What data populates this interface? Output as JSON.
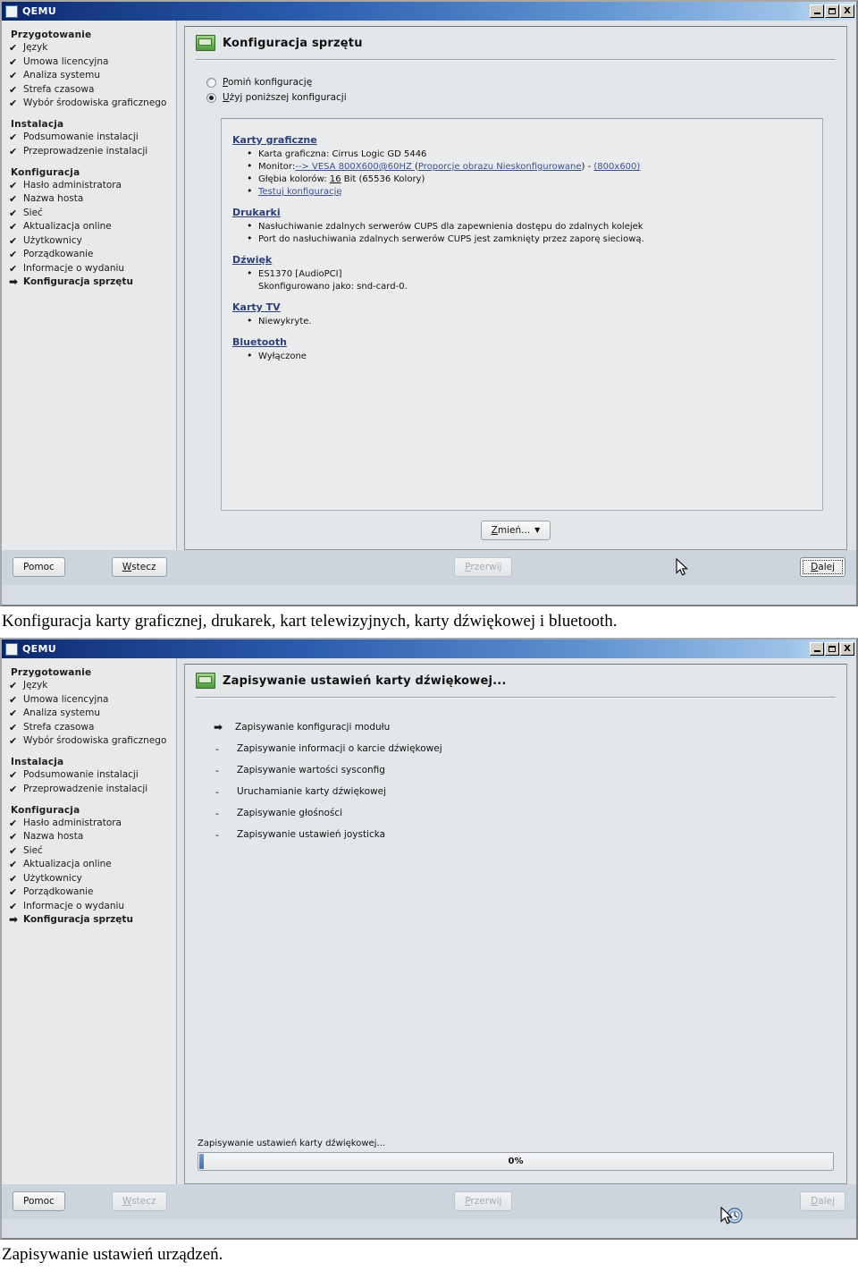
{
  "sidebar": {
    "groups": [
      {
        "title": "Przygotowanie",
        "items": [
          {
            "mark": "✔",
            "label": "Język"
          },
          {
            "mark": "✔",
            "label": "Umowa licencyjna"
          },
          {
            "mark": "✔",
            "label": "Analiza systemu"
          },
          {
            "mark": "✔",
            "label": "Strefa czasowa"
          },
          {
            "mark": "✔",
            "label": "Wybór środowiska graficznego"
          }
        ]
      },
      {
        "title": "Instalacja",
        "items": [
          {
            "mark": "✔",
            "label": "Podsumowanie instalacji"
          },
          {
            "mark": "✔",
            "label": "Przeprowadzenie instalacji"
          }
        ]
      },
      {
        "title": "Konfiguracja",
        "items": [
          {
            "mark": "✔",
            "label": "Hasło administratora"
          },
          {
            "mark": "✔",
            "label": "Nazwa hosta"
          },
          {
            "mark": "✔",
            "label": "Sieć"
          },
          {
            "mark": "✔",
            "label": "Aktualizacja online"
          },
          {
            "mark": "✔",
            "label": "Użytkownicy"
          },
          {
            "mark": "✔",
            "label": "Porządkowanie"
          },
          {
            "mark": "✔",
            "label": "Informacje o wydaniu"
          },
          {
            "mark": "➡",
            "label": "Konfiguracja sprzętu",
            "current": true
          }
        ]
      }
    ]
  },
  "window1": {
    "title": "QEMU",
    "window_buttons": {
      "minimize": "minimize-icon",
      "maximize": "maximize-icon",
      "close": "X"
    },
    "dialog_title": "Konfiguracja sprzętu",
    "radios": [
      {
        "label_pre": "",
        "label_accel": "P",
        "label_post": "omiń konfigurację",
        "selected": false
      },
      {
        "label_pre": "",
        "label_accel": "U",
        "label_post": "żyj poniższej konfiguracji",
        "selected": true
      }
    ],
    "sections": [
      {
        "heading": "Karty graficzne",
        "lines": [
          "Karta graficzna: Cirrus Logic GD 5446",
          "Monitor:--> VESA 800X600@60HZ (Proporcje obrazu Nieskonfigurowane) - (800x600)",
          "Głębia kolorów: 16 Bit (65536 Kolory)",
          "Testuj konfigurację"
        ]
      },
      {
        "heading": "Drukarki",
        "lines": [
          "Nasłuchiwanie zdalnych serwerów CUPS dla zapewnienia dostępu do zdalnych kolejek",
          "Port do nasłuchiwania zdalnych serwerów CUPS jest zamknięty przez zaporę sieciową."
        ]
      },
      {
        "heading": "Dźwięk",
        "lines": [
          "ES1370 [AudioPCI]",
          "Skonfigurowano jako: snd-card-0."
        ]
      },
      {
        "heading": "Karty TV",
        "lines": [
          "Niewykryte."
        ]
      },
      {
        "heading": "Bluetooth",
        "lines": [
          "Wyłączone"
        ]
      }
    ],
    "change_button": {
      "accel": "Z",
      "rest": "mień...",
      "caret": "▼"
    },
    "buttons": {
      "help": "Pomoc",
      "back_accel": "W",
      "back_rest": "stecz",
      "abort_accel": "P",
      "abort_rest": "rzerwij",
      "next_accel": "D",
      "next_rest": "alej"
    }
  },
  "caption1": "Konfiguracja karty graficznej, drukarek, kart telewizyjnych, karty dźwiękowej i bluetooth.",
  "window2": {
    "title": "QEMU",
    "dialog_title": "Zapisywanie ustawień karty dźwiękowej...",
    "steps": [
      {
        "mark": "➡",
        "label": "Zapisywanie konfiguracji modułu",
        "active": true
      },
      {
        "mark": "-",
        "label": "Zapisywanie informacji o karcie dźwiękowej",
        "active": false
      },
      {
        "mark": "-",
        "label": "Zapisywanie wartości sysconfig",
        "active": false
      },
      {
        "mark": "-",
        "label": "Uruchamianie karty dźwiękowej",
        "active": false
      },
      {
        "mark": "-",
        "label": "Zapisywanie głośności",
        "active": false
      },
      {
        "mark": "-",
        "label": "Zapisywanie ustawień joysticka",
        "active": false
      }
    ],
    "progress_label": "Zapisywanie ustawień karty dźwiękowej...",
    "progress_percent": "0%",
    "progress_value": 0,
    "buttons": {
      "help": "Pomoc",
      "back_accel": "W",
      "back_rest": "stecz",
      "abort_accel": "P",
      "abort_rest": "rzerwij",
      "next_accel": "D",
      "next_rest": "alej"
    }
  },
  "caption2": "Zapisywanie ustawień urządzeń.",
  "colors": {
    "title_start": "#0a246a",
    "title_end": "#cfe2f3",
    "link": "#3d4f93",
    "panel": "#e4e7e9",
    "bottom_bar": "#ccd5de",
    "progress_fill": "#3f6fb5"
  }
}
